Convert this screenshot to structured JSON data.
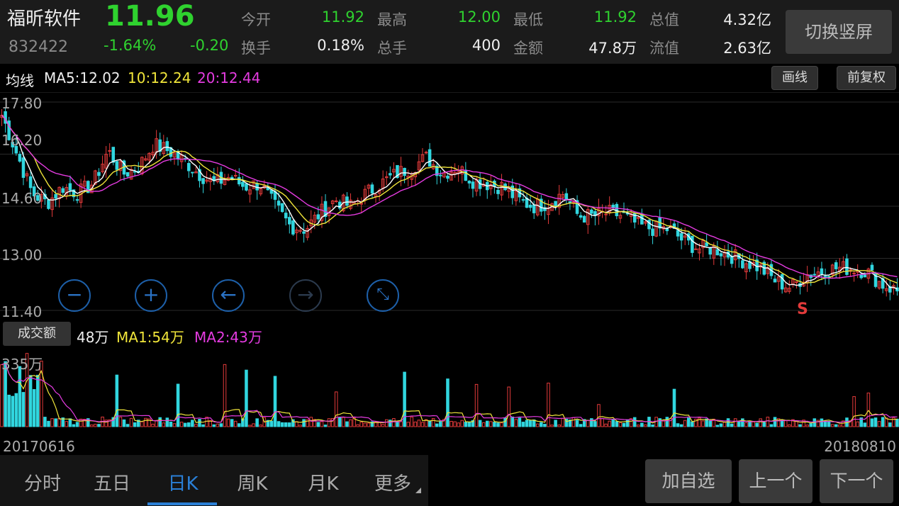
{
  "header": {
    "stock_name": "福昕软件",
    "stock_code": "832422",
    "last_price": "11.96",
    "change_pct": "-1.64%",
    "change": "-0.20",
    "quotes": [
      {
        "label": "今开",
        "value": "11.92",
        "color": "green"
      },
      {
        "label": "最高",
        "value": "12.00",
        "color": "green"
      },
      {
        "label": "最低",
        "value": "11.92",
        "color": "green"
      },
      {
        "label": "总值",
        "value": "4.32亿",
        "color": "white"
      },
      {
        "label": "换手",
        "value": "0.18%",
        "color": "white"
      },
      {
        "label": "总手",
        "value": "400",
        "color": "white"
      },
      {
        "label": "金额",
        "value": "47.8万",
        "color": "white"
      },
      {
        "label": "流值",
        "value": "2.63亿",
        "color": "white"
      }
    ],
    "switch_button": "切换竖屏"
  },
  "ma_bar": {
    "title": "均线",
    "ma5": "MA5:12.02",
    "ma10": "10:12.24",
    "ma20": "20:12.44",
    "draw_button": "画线",
    "adjust_button": "前复权"
  },
  "kline_axis": [
    "17.80",
    "16.20",
    "14.60",
    "13.00",
    "11.40"
  ],
  "signal_marker": "S",
  "volume_bar": {
    "button": "成交额",
    "current": "48万",
    "ma1": "MA1:54万",
    "ma2": "MA2:43万",
    "top_label": "335万"
  },
  "dates": {
    "start": "20170616",
    "end": "20180810"
  },
  "tabs": [
    "分时",
    "五日",
    "日K",
    "周K",
    "月K",
    "更多"
  ],
  "actions": [
    "加自选",
    "上一个",
    "下一个"
  ],
  "colors": {
    "up": "#e23a3a",
    "down": "#31d6df",
    "ma5": "#ffffff",
    "ma10": "#f0e53a",
    "ma20": "#e43be0",
    "accent": "#2a7fd6"
  },
  "chart_data": {
    "type": "candlestick",
    "ylim": [
      11.4,
      17.8
    ],
    "approx_close_path": [
      17.4,
      16.2,
      15.0,
      14.7,
      15.2,
      15.0,
      15.3,
      16.3,
      15.6,
      15.8,
      16.5,
      16.3,
      16.0,
      15.6,
      15.3,
      15.5,
      15.2,
      15.3,
      14.6,
      14.0,
      13.9,
      14.4,
      14.8,
      14.6,
      15.0,
      15.3,
      15.6,
      15.8,
      16.1,
      15.6,
      15.8,
      15.4,
      15.3,
      15.2,
      14.8,
      14.6,
      14.7,
      15.0,
      14.3,
      14.3,
      14.4,
      14.3,
      14.0,
      13.9,
      13.9,
      13.5,
      13.3,
      13.3,
      13.1,
      12.9,
      12.7,
      12.3,
      12.1,
      12.5,
      12.6,
      12.7,
      12.7,
      12.6,
      12.2,
      12.0
    ]
  }
}
